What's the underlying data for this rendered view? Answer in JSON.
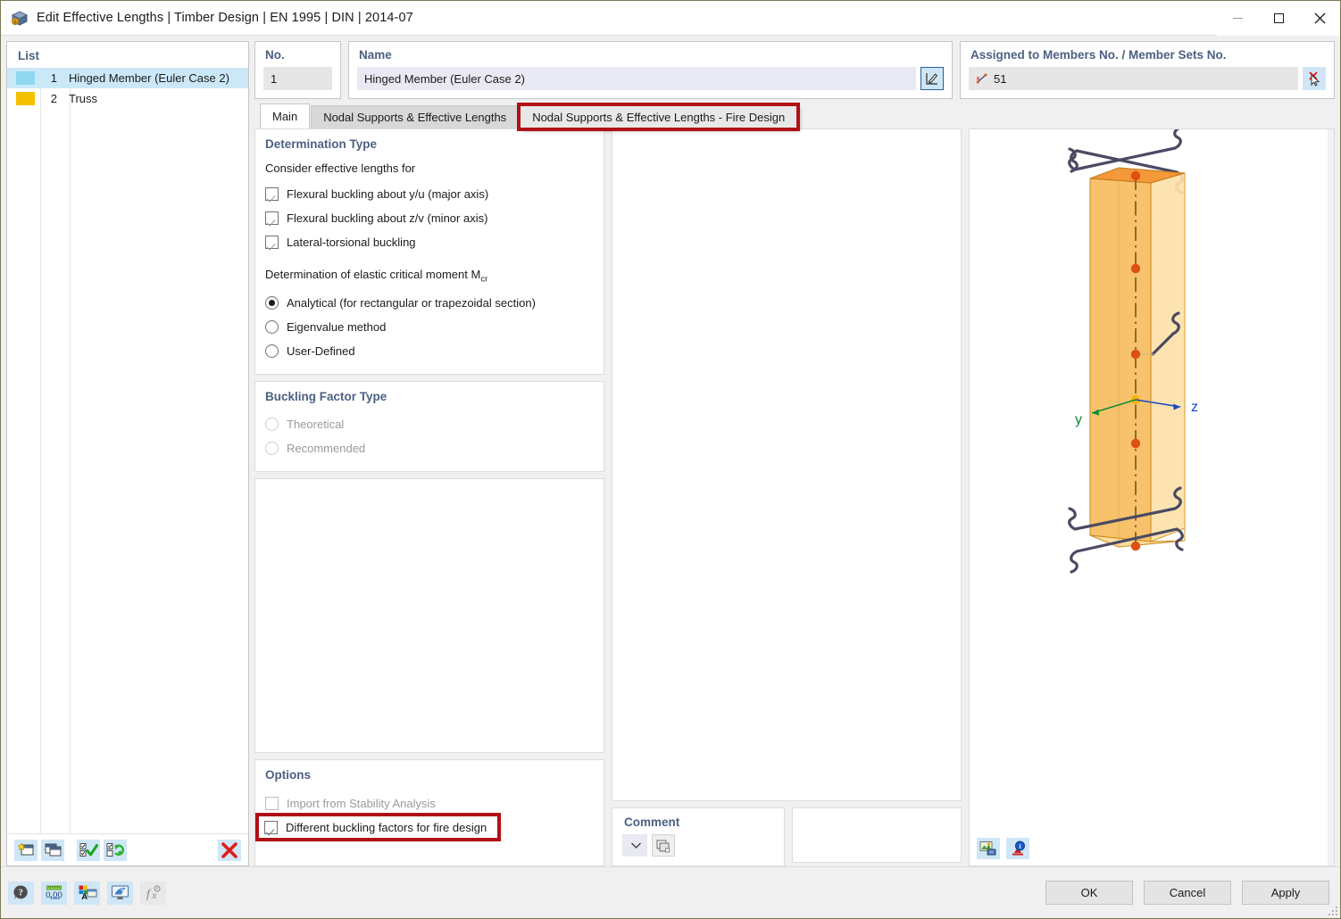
{
  "window": {
    "title": "Edit Effective Lengths | Timber Design | EN 1995 | DIN | 2014-07",
    "app_icon": "cube-icon",
    "minimize": "minimize-icon",
    "maximize": "maximize-icon",
    "close": "close-icon"
  },
  "list_panel": {
    "title": "List",
    "items": [
      {
        "no": "1",
        "label": "Hinged Member (Euler Case 2)",
        "color": "#8fd8ef",
        "selected": true
      },
      {
        "no": "2",
        "label": "Truss",
        "color": "#f5c000",
        "selected": false
      }
    ],
    "toolbar": [
      {
        "name": "new-item-button",
        "icon": "new-window-star-icon"
      },
      {
        "name": "duplicate-item-button",
        "icon": "copy-windows-icon"
      },
      {
        "name": "select-all-button",
        "icon": "checkboxes-check-icon"
      },
      {
        "name": "invert-selection-button",
        "icon": "checkboxes-swap-icon"
      },
      {
        "name": "delete-item-button",
        "icon": "red-x-icon"
      }
    ]
  },
  "header": {
    "no_label": "No.",
    "no_value": "1",
    "name_label": "Name",
    "name_value": "Hinged Member (Euler Case 2)",
    "name_edit_icon": "pencil-edit-icon",
    "assigned_label": "Assigned to Members No. / Member Sets No.",
    "assigned_value": "51",
    "assigned_value_icon": "member-line-icon",
    "assigned_pick_icon": "pick-cursor-icon"
  },
  "tabs": [
    {
      "label": "Main",
      "active": true,
      "highlighted": false
    },
    {
      "label": "Nodal Supports & Effective Lengths",
      "active": false,
      "highlighted": false
    },
    {
      "label": "Nodal Supports & Effective Lengths - Fire Design",
      "active": false,
      "highlighted": true
    }
  ],
  "determination": {
    "title": "Determination Type",
    "consider_label": "Consider effective lengths for",
    "checkboxes": [
      {
        "label": "Flexural buckling about y/u (major axis)",
        "checked": true,
        "enabled": false
      },
      {
        "label": "Flexural buckling about z/v (minor axis)",
        "checked": true,
        "enabled": false
      },
      {
        "label": "Lateral-torsional buckling",
        "checked": true,
        "enabled": false
      }
    ],
    "mcr_label_pre": "Determination of elastic critical moment M",
    "mcr_label_sub": "cr",
    "radios": [
      {
        "label": "Analytical (for rectangular or trapezoidal section)",
        "selected": true,
        "enabled": true
      },
      {
        "label": "Eigenvalue method",
        "selected": false,
        "enabled": true
      },
      {
        "label": "User-Defined",
        "selected": false,
        "enabled": true
      }
    ]
  },
  "buckling_factor": {
    "title": "Buckling Factor Type",
    "radios": [
      {
        "label": "Theoretical",
        "selected": false,
        "enabled": false
      },
      {
        "label": "Recommended",
        "selected": false,
        "enabled": false
      }
    ]
  },
  "options": {
    "title": "Options",
    "checkboxes": [
      {
        "label": "Import from Stability Analysis",
        "checked": false,
        "enabled": false,
        "highlighted": false
      },
      {
        "label": "Different buckling factors for fire design",
        "checked": true,
        "enabled": true,
        "highlighted": true
      }
    ]
  },
  "comment": {
    "title": "Comment",
    "value": "",
    "placeholder": "",
    "dropdown_icon": "chevron-down-icon",
    "button_icon": "comment-library-icon"
  },
  "view3d": {
    "axis_y_label": "y",
    "axis_z_label": "z",
    "axis_y_color": "#108a2f",
    "axis_z_color": "#1847c8",
    "member_fill": "#fbd88b",
    "member_fill_dark": "#f2a93b",
    "member_stroke": "#c98b1c",
    "node_color": "#d94f12",
    "origin_color": "#f5b400",
    "support_color": "#4a4a63",
    "tools": [
      {
        "name": "view-render-button",
        "icon": "render-mode-icon"
      },
      {
        "name": "view-info-button",
        "icon": "info-balloon-icon"
      }
    ]
  },
  "footer": {
    "icons": [
      {
        "name": "help-button",
        "icon": "help-question-icon",
        "enabled": true
      },
      {
        "name": "number-format-button",
        "icon": "number-format-icon",
        "enabled": true
      },
      {
        "name": "font-color-button",
        "icon": "font-color-icon",
        "enabled": true
      },
      {
        "name": "display-properties-button",
        "icon": "display-monitor-icon",
        "enabled": true
      },
      {
        "name": "formula-button",
        "icon": "fx-formula-icon",
        "enabled": false
      }
    ],
    "buttons": [
      {
        "label": "OK",
        "name": "ok-button"
      },
      {
        "label": "Cancel",
        "name": "cancel-button"
      },
      {
        "label": "Apply",
        "name": "apply-button"
      }
    ]
  }
}
